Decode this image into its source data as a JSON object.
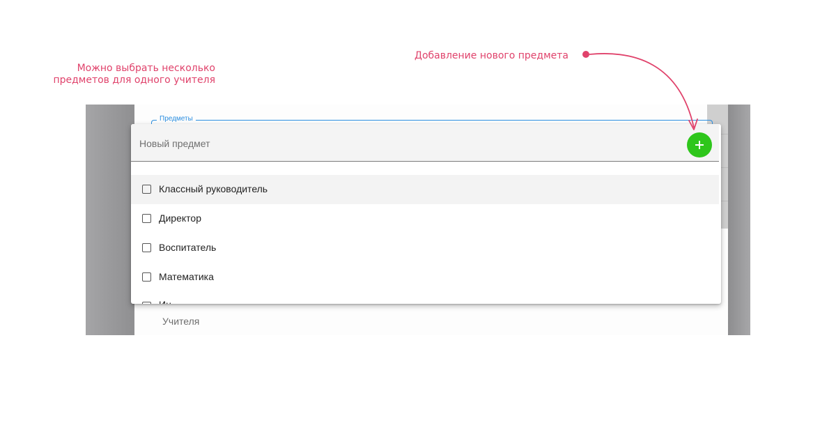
{
  "annotations": {
    "left_line1": "Можно выбрать несколько",
    "left_line2": "предметов для одного учителя",
    "right": "Добавление нового предмета"
  },
  "field": {
    "legend": "Предметы"
  },
  "dropdown": {
    "new_subject_placeholder": "Новый предмет",
    "items": [
      {
        "label": "Классный руководитель",
        "checked": false
      },
      {
        "label": "Директор",
        "checked": false
      },
      {
        "label": "Воспитатель",
        "checked": false
      },
      {
        "label": "Математика",
        "checked": false
      },
      {
        "label": "Ин",
        "checked": false
      }
    ]
  },
  "background": {
    "teachers_label": "Учителя"
  },
  "colors": {
    "annotation": "#e0426b",
    "accent": "#2b8ee0",
    "add_button": "#2ec61b"
  }
}
